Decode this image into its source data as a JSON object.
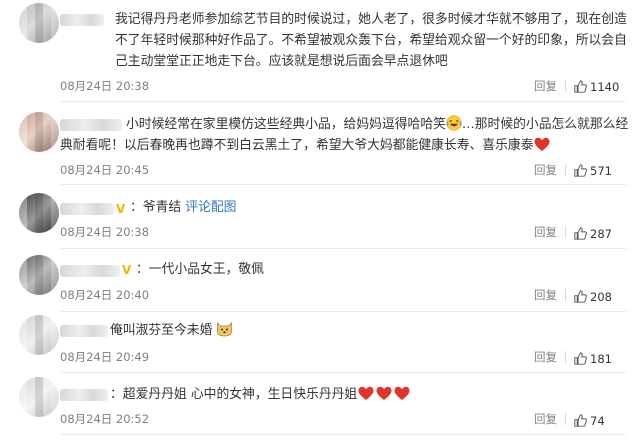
{
  "comments": [
    {
      "text": "我记得丹丹老师参加综艺节目的时候说过，她人老了，很多时候才华就不够用了，现在创造不了年轻时候那种好作品了。不希望被观众轰下台，希望给观众留一个好的印象，所以会自己主动堂堂正正地走下台。应该就是想说后面会早点退休吧",
      "time": "08月24日 20:38",
      "reply": "回复",
      "likes": "1140"
    },
    {
      "text_a": "小时候经常在家里模仿这些经典小品，给妈妈逗得哈哈笑",
      "text_b": "…那时候的小品怎么就那么经典耐看呢！以后春晚再也蹲不到白云黑土了，希望大爷大妈都能健康长寿、喜乐康泰",
      "time": "08月24日 20:45",
      "reply": "回复",
      "likes": "571"
    },
    {
      "text_a": "：爷青结",
      "link": "评论配图",
      "time": "08月24日 20:38",
      "reply": "回复",
      "likes": "287"
    },
    {
      "text": "：一代小品女王，敬佩",
      "time": "08月24日 20:40",
      "reply": "回复",
      "likes": "208"
    },
    {
      "text": "俺叫淑芬至今未婚",
      "time": "08月24日 20:49",
      "reply": "回复",
      "likes": "181"
    },
    {
      "text": "：超爱丹丹姐 心中的女神，生日快乐丹丹姐",
      "time": "08月24日 20:52",
      "reply": "回复",
      "likes": "74"
    }
  ],
  "colors": {
    "text": "#333333",
    "meta": "#808080",
    "link": "#2e76c2",
    "vip": "#f4b400",
    "heart": "#e0352b"
  },
  "icons": [
    "like-thumb-icon",
    "vip-icon",
    "laugh-cry-emoji",
    "red-heart-emoji",
    "doge-emoji"
  ]
}
